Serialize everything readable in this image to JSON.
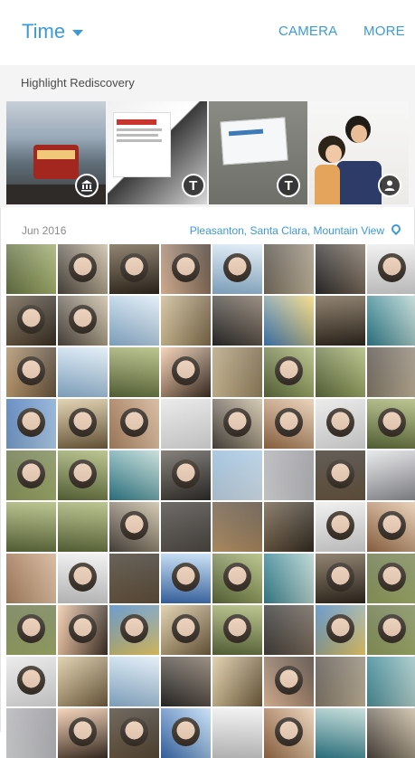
{
  "header": {
    "view_label": "Time",
    "camera_label": "CAMERA",
    "more_label": "MORE",
    "accent": "#3b9ad8"
  },
  "highlight": {
    "title": "Highlight Rediscovery",
    "cards": [
      {
        "badge_icon": "landmark-icon",
        "badge_text": ""
      },
      {
        "badge_icon": "text-icon",
        "badge_text": "T"
      },
      {
        "badge_icon": "text-icon",
        "badge_text": "T"
      },
      {
        "badge_icon": "person-icon",
        "badge_text": ""
      }
    ]
  },
  "section": {
    "date": "Jun 2016",
    "location": "Pleasanton, Santa Clara, Mountain View",
    "location_icon": "location-pin-icon"
  }
}
